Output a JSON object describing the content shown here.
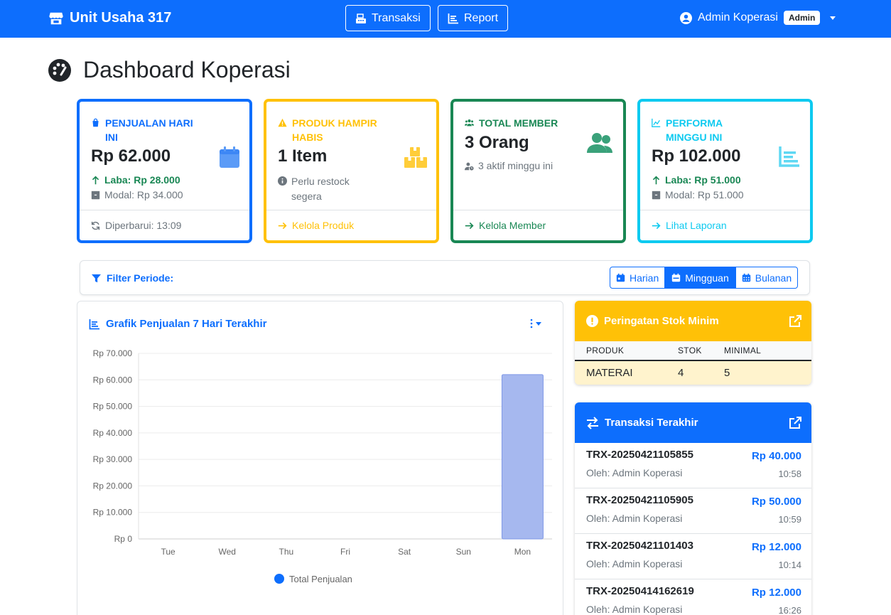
{
  "navbar": {
    "brand": "Unit Usaha 317",
    "links": [
      {
        "label": "Transaksi",
        "icon": "cash-register-icon"
      },
      {
        "label": "Report",
        "icon": "chart-line-icon"
      }
    ],
    "user_name": "Admin Koperasi",
    "role_badge": "Admin"
  },
  "page": {
    "title": "Dashboard Koperasi"
  },
  "cards": {
    "sales": {
      "label": "Penjualan Hari Ini",
      "value": "Rp 62.000",
      "profit": "Laba: Rp 28.000",
      "capital": "Modal: Rp 34.000",
      "footer": "Diperbarui: 13:09",
      "color": "#0d6efd"
    },
    "stock": {
      "label": "Produk Hampir Habis",
      "value": "1 Item",
      "note": "Perlu restock segera",
      "footer": "Kelola Produk",
      "color": "#ffc107"
    },
    "members": {
      "label": "Total Member",
      "value": "3 Orang",
      "note": "3 aktif minggu ini",
      "footer": "Kelola Member",
      "color": "#198754"
    },
    "weekly": {
      "label": "Performa Minggu Ini",
      "value": "Rp 102.000",
      "profit": "Laba: Rp 51.000",
      "capital": "Modal: Rp 51.000",
      "footer": "Lihat Laporan",
      "color": "#0dcaf0"
    }
  },
  "filter": {
    "title": "Filter Periode:",
    "options": [
      "Harian",
      "Mingguan",
      "Bulanan"
    ],
    "active": "Mingguan"
  },
  "chart_card": {
    "title": "Grafik Penjualan 7 Hari Terakhir"
  },
  "chart_data": {
    "type": "bar",
    "categories": [
      "Tue",
      "Wed",
      "Thu",
      "Fri",
      "Sat",
      "Sun",
      "Mon"
    ],
    "series": [
      {
        "name": "Total Penjualan",
        "values": [
          0,
          0,
          0,
          0,
          0,
          0,
          62000
        ],
        "color": "#a6b8ef"
      }
    ],
    "ylim": [
      0,
      70000
    ],
    "yticks": [
      "Rp 0",
      "Rp 10.000",
      "Rp 20.000",
      "Rp 30.000",
      "Rp 40.000",
      "Rp 50.000",
      "Rp 60.000",
      "Rp 70.000"
    ],
    "legend": "bottom",
    "grid": true
  },
  "stock_alert": {
    "title": "Peringatan Stok Minim",
    "headers": [
      "PRODUK",
      "STOK",
      "MINIMAL"
    ],
    "rows": [
      [
        "MATERAI",
        "4",
        "5"
      ]
    ]
  },
  "transactions": {
    "title": "Transaksi Terakhir",
    "items": [
      {
        "id": "TRX-20250421105855",
        "by": "Oleh: Admin Koperasi",
        "amount": "Rp 40.000",
        "time": "10:58"
      },
      {
        "id": "TRX-20250421105905",
        "by": "Oleh: Admin Koperasi",
        "amount": "Rp 50.000",
        "time": "10:59"
      },
      {
        "id": "TRX-20250421101403",
        "by": "Oleh: Admin Koperasi",
        "amount": "Rp 12.000",
        "time": "10:14"
      },
      {
        "id": "TRX-20250414162619",
        "by": "Oleh: Admin Koperasi",
        "amount": "Rp 12.000",
        "time": "16:26"
      }
    ]
  }
}
